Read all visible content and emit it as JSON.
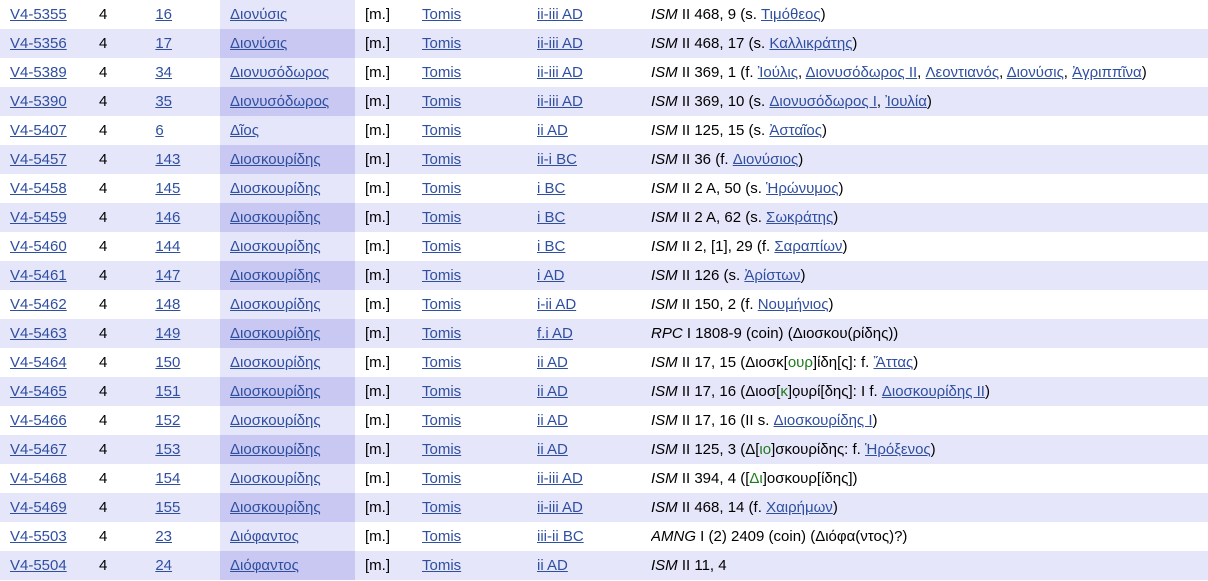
{
  "rows": [
    {
      "id": "V4-5355",
      "vol": "4",
      "num": "16",
      "name": "Διονύσις",
      "sex": "[m.]",
      "place": "Tomis",
      "date": "ii-iii AD",
      "ref": [
        {
          "t": "ISM",
          "s": "i"
        },
        {
          "t": " II 468, 9 (s. "
        },
        {
          "t": "Τιμόθεος",
          "s": "a"
        },
        {
          "t": ")"
        }
      ]
    },
    {
      "id": "V4-5356",
      "vol": "4",
      "num": "17",
      "name": "Διονύσις",
      "sex": "[m.]",
      "place": "Tomis",
      "date": "ii-iii AD",
      "ref": [
        {
          "t": "ISM",
          "s": "i"
        },
        {
          "t": " II 468, 17 (s. "
        },
        {
          "t": "Καλλικράτης",
          "s": "a"
        },
        {
          "t": ")"
        }
      ]
    },
    {
      "id": "V4-5389",
      "vol": "4",
      "num": "34",
      "name": "Διονυσόδωρος",
      "sex": "[m.]",
      "place": "Tomis",
      "date": "ii-iii AD",
      "ref": [
        {
          "t": "ISM",
          "s": "i"
        },
        {
          "t": " II 369, 1 (f. "
        },
        {
          "t": "Ἰούλις",
          "s": "a"
        },
        {
          "t": ", "
        },
        {
          "t": "Διονυσόδωρος II",
          "s": "a"
        },
        {
          "t": ", "
        },
        {
          "t": "Λεοντιανός",
          "s": "a"
        },
        {
          "t": ", "
        },
        {
          "t": "Διονύσις",
          "s": "a"
        },
        {
          "t": ", "
        },
        {
          "t": "Ἀγριππῖνα",
          "s": "a"
        },
        {
          "t": ")"
        }
      ]
    },
    {
      "id": "V4-5390",
      "vol": "4",
      "num": "35",
      "name": "Διονυσόδωρος",
      "sex": "[m.]",
      "place": "Tomis",
      "date": "ii-iii AD",
      "ref": [
        {
          "t": "ISM",
          "s": "i"
        },
        {
          "t": " II 369, 10 (s. "
        },
        {
          "t": "Διονυσόδωρος I",
          "s": "a"
        },
        {
          "t": ", "
        },
        {
          "t": "Ἰουλία",
          "s": "a"
        },
        {
          "t": ")"
        }
      ]
    },
    {
      "id": "V4-5407",
      "vol": "4",
      "num": "6",
      "name": "Δῖος",
      "sex": "[m.]",
      "place": "Tomis",
      "date": "ii AD",
      "ref": [
        {
          "t": "ISM",
          "s": "i"
        },
        {
          "t": " II 125, 15 (s. "
        },
        {
          "t": "Ἀσταῖος",
          "s": "a"
        },
        {
          "t": ")"
        }
      ]
    },
    {
      "id": "V4-5457",
      "vol": "4",
      "num": "143",
      "name": "Διοσκουρίδης",
      "sex": "[m.]",
      "place": "Tomis",
      "date": "ii-i BC",
      "ref": [
        {
          "t": "ISM",
          "s": "i"
        },
        {
          "t": " II 36 (f. "
        },
        {
          "t": "Διονύσιος",
          "s": "a"
        },
        {
          "t": ")"
        }
      ]
    },
    {
      "id": "V4-5458",
      "vol": "4",
      "num": "145",
      "name": "Διοσκουρίδης",
      "sex": "[m.]",
      "place": "Tomis",
      "date": "i BC",
      "ref": [
        {
          "t": "ISM",
          "s": "i"
        },
        {
          "t": " II 2 A, 50 (s. "
        },
        {
          "t": "Ἡρώνυμος",
          "s": "a"
        },
        {
          "t": ")"
        }
      ]
    },
    {
      "id": "V4-5459",
      "vol": "4",
      "num": "146",
      "name": "Διοσκουρίδης",
      "sex": "[m.]",
      "place": "Tomis",
      "date": "i BC",
      "ref": [
        {
          "t": "ISM",
          "s": "i"
        },
        {
          "t": " II 2 A, 62 (s. "
        },
        {
          "t": "Σωκράτης",
          "s": "a"
        },
        {
          "t": ")"
        }
      ]
    },
    {
      "id": "V4-5460",
      "vol": "4",
      "num": "144",
      "name": "Διοσκουρίδης",
      "sex": "[m.]",
      "place": "Tomis",
      "date": "i BC",
      "ref": [
        {
          "t": "ISM",
          "s": "i"
        },
        {
          "t": " II 2, [1], 29 (f. "
        },
        {
          "t": "Σαραπίων",
          "s": "a"
        },
        {
          "t": ")"
        }
      ]
    },
    {
      "id": "V4-5461",
      "vol": "4",
      "num": "147",
      "name": "Διοσκουρίδης",
      "sex": "[m.]",
      "place": "Tomis",
      "date": "i AD",
      "ref": [
        {
          "t": "ISM",
          "s": "i"
        },
        {
          "t": " II 126 (s. "
        },
        {
          "t": "Ἀρίστων",
          "s": "a"
        },
        {
          "t": ")"
        }
      ]
    },
    {
      "id": "V4-5462",
      "vol": "4",
      "num": "148",
      "name": "Διοσκουρίδης",
      "sex": "[m.]",
      "place": "Tomis",
      "date": "i-ii AD",
      "ref": [
        {
          "t": "ISM",
          "s": "i"
        },
        {
          "t": " II 150, 2 (f. "
        },
        {
          "t": "Νουμήνιος",
          "s": "a"
        },
        {
          "t": ")"
        }
      ]
    },
    {
      "id": "V4-5463",
      "vol": "4",
      "num": "149",
      "name": "Διοσκουρίδης",
      "sex": "[m.]",
      "place": "Tomis",
      "date": "f.i AD",
      "ref": [
        {
          "t": "RPC",
          "s": "i"
        },
        {
          "t": " I 1808-9 (coin) (Διοσκου(ρίδης))"
        }
      ]
    },
    {
      "id": "V4-5464",
      "vol": "4",
      "num": "150",
      "name": "Διοσκουρίδης",
      "sex": "[m.]",
      "place": "Tomis",
      "date": "ii AD",
      "ref": [
        {
          "t": "ISM",
          "s": "i"
        },
        {
          "t": " II 17, 15 (Διοσκ["
        },
        {
          "t": "ουρ",
          "s": "g"
        },
        {
          "t": "]ίδη[ς]: f. "
        },
        {
          "t": "Ἄττας",
          "s": "a"
        },
        {
          "t": ")"
        }
      ]
    },
    {
      "id": "V4-5465",
      "vol": "4",
      "num": "151",
      "name": "Διοσκουρίδης",
      "sex": "[m.]",
      "place": "Tomis",
      "date": "ii AD",
      "ref": [
        {
          "t": "ISM",
          "s": "i"
        },
        {
          "t": " II 17, 16 (Διοσ["
        },
        {
          "t": "κ",
          "s": "g"
        },
        {
          "t": "]ọυρί[δης]: I f. "
        },
        {
          "t": "Διοσκουρίδης II",
          "s": "a"
        },
        {
          "t": ")"
        }
      ]
    },
    {
      "id": "V4-5466",
      "vol": "4",
      "num": "152",
      "name": "Διοσκουρίδης",
      "sex": "[m.]",
      "place": "Tomis",
      "date": "ii AD",
      "ref": [
        {
          "t": "ISM",
          "s": "i"
        },
        {
          "t": " II 17, 16 (II s. "
        },
        {
          "t": "Διοσκουρίδης I",
          "s": "a"
        },
        {
          "t": ")"
        }
      ]
    },
    {
      "id": "V4-5467",
      "vol": "4",
      "num": "153",
      "name": "Διοσκουρίδης",
      "sex": "[m.]",
      "place": "Tomis",
      "date": "ii AD",
      "ref": [
        {
          "t": "ISM",
          "s": "i"
        },
        {
          "t": " II 125, 3 (Δ["
        },
        {
          "t": "ιο",
          "s": "g"
        },
        {
          "t": "]σκουρίδης: f. "
        },
        {
          "t": "Ἡρόξενος",
          "s": "a"
        },
        {
          "t": ")"
        }
      ]
    },
    {
      "id": "V4-5468",
      "vol": "4",
      "num": "154",
      "name": "Διοσκουρίδης",
      "sex": "[m.]",
      "place": "Tomis",
      "date": "ii-iii AD",
      "ref": [
        {
          "t": "ISM",
          "s": "i"
        },
        {
          "t": " II 394, 4 (["
        },
        {
          "t": "Δι",
          "s": "g"
        },
        {
          "t": "]οσκουρ[ίδης])"
        }
      ]
    },
    {
      "id": "V4-5469",
      "vol": "4",
      "num": "155",
      "name": "Διοσκουρίδης",
      "sex": "[m.]",
      "place": "Tomis",
      "date": "ii-iii AD",
      "ref": [
        {
          "t": "ISM",
          "s": "i"
        },
        {
          "t": " II 468, 14 (f. "
        },
        {
          "t": "Χαιρήμων",
          "s": "a"
        },
        {
          "t": ")"
        }
      ]
    },
    {
      "id": "V4-5503",
      "vol": "4",
      "num": "23",
      "name": "Διόφαντος",
      "sex": "[m.]",
      "place": "Tomis",
      "date": "iii-ii BC",
      "ref": [
        {
          "t": "AMNG",
          "s": "i"
        },
        {
          "t": " I (2) 2409 (coin) (Διόφα(ντος)?)"
        }
      ]
    },
    {
      "id": "V4-5504",
      "vol": "4",
      "num": "24",
      "name": "Διόφαντος",
      "sex": "[m.]",
      "place": "Tomis",
      "date": "ii AD",
      "ref": [
        {
          "t": "ISM",
          "s": "i"
        },
        {
          "t": " II 11, 4"
        }
      ]
    }
  ]
}
